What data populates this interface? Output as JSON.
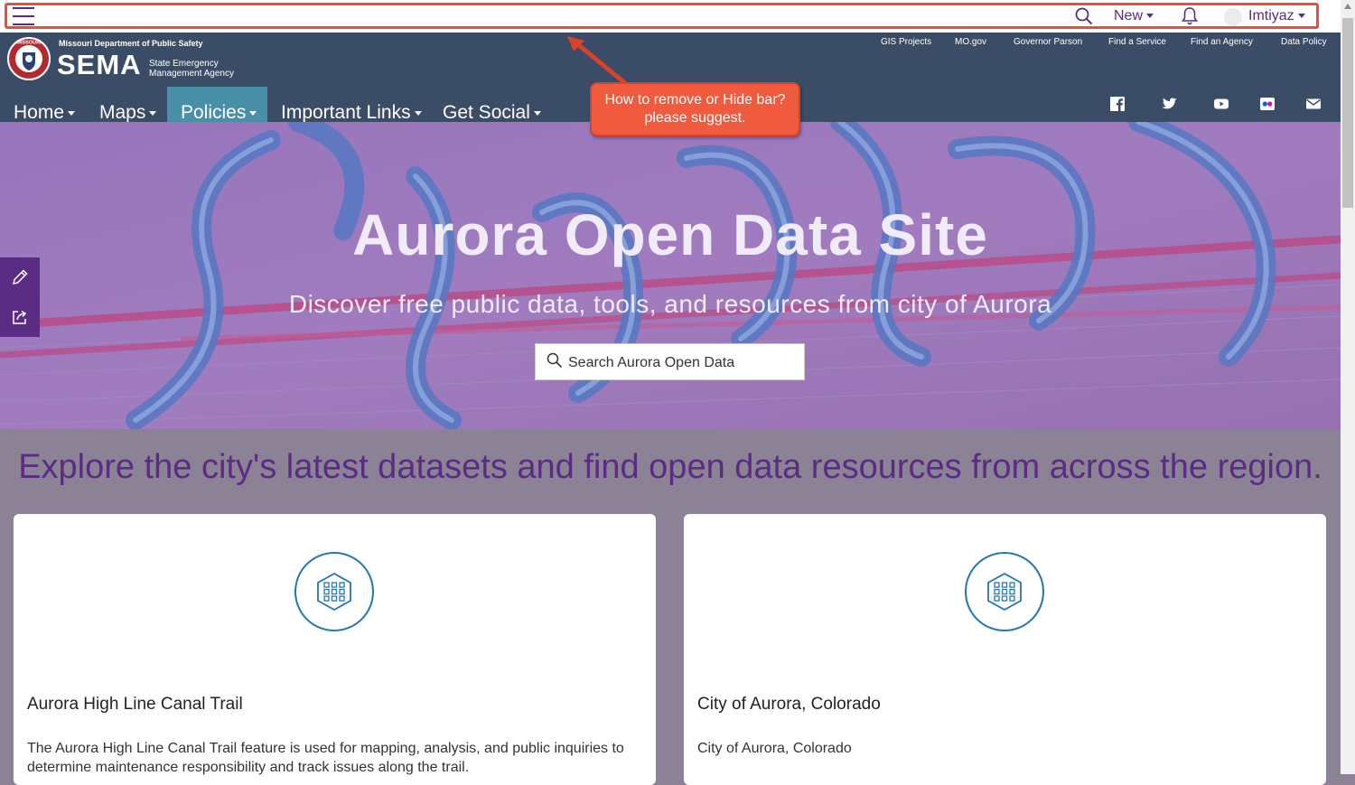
{
  "topbar": {
    "new_label": "New",
    "user_name": "Imtiyaz"
  },
  "header": {
    "dept": "Missouri Department of Public Safety",
    "brand": "SEMA",
    "agency": "State Emergency Management Agency",
    "seal_text": "MISSOURI",
    "top_links": [
      "GIS Projects",
      "MO.gov",
      "Governor Parson",
      "Find a Service",
      "Find an Agency",
      "Data Policy"
    ],
    "nav": [
      "Home",
      "Maps",
      "Policies",
      "Important Links",
      "Get Social"
    ],
    "active_nav": "Policies",
    "social_icons": [
      "facebook-icon",
      "twitter-icon",
      "youtube-icon",
      "flickr-icon",
      "mail-icon"
    ]
  },
  "hero": {
    "title": "Aurora Open Data Site",
    "subtitle": "Discover free public data, tools, and resources from city of Aurora",
    "search_placeholder": "Search Aurora Open Data"
  },
  "side_tools": [
    "edit-icon",
    "share-icon"
  ],
  "explore": {
    "heading": "Explore the city's latest datasets and find open data resources from across the region."
  },
  "cards": [
    {
      "title": "Aurora High Line Canal Trail",
      "description": "The Aurora High Line Canal Trail feature is used for mapping, analysis, and public inquiries to determine maintenance responsibility and track issues along the trail."
    },
    {
      "title": "City of Aurora, Colorado",
      "description": "City of Aurora, Colorado"
    }
  ],
  "annotation": {
    "text": "How to remove or Hide bar? please suggest."
  },
  "colors": {
    "brand_purple": "#5b2c83",
    "header_bg": "#3b4c66",
    "active_nav": "#4a8fa8",
    "callout": "#f05a3d",
    "card_icon": "#1f77b4"
  }
}
